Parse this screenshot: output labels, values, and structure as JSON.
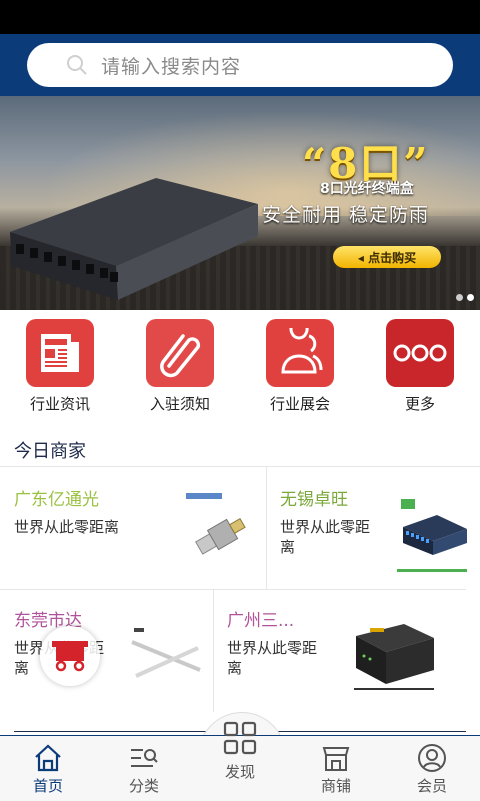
{
  "search": {
    "placeholder": "请输入搜索内容"
  },
  "banner": {
    "title": "“8口”",
    "subtitle": "8口光纤终端盒",
    "tagline": "安全耐用 稳定防雨",
    "cta": "◂ 点击购买",
    "dots_total": 2,
    "active_dot": 2
  },
  "categories": [
    {
      "label": "行业资讯",
      "icon": "newspaper-icon",
      "color": "#e0413f"
    },
    {
      "label": "入驻须知",
      "icon": "paperclip-icon",
      "color": "#e24a4a"
    },
    {
      "label": "行业展会",
      "icon": "people-icon",
      "color": "#e0413f"
    },
    {
      "label": "更多",
      "icon": "more-icon",
      "color": "#c8262a"
    }
  ],
  "today": {
    "title": "今日商家"
  },
  "merchants": [
    {
      "name": "广东亿通光",
      "desc": "世界从此零距离",
      "name_color": "#9bc142"
    },
    {
      "name": "无锡卓旺",
      "desc": "世界从此零距离",
      "name_color": "#7aa83a"
    },
    {
      "name": "东莞市达",
      "desc": "世界从此零距离",
      "name_color": "#b0539a"
    },
    {
      "name": "广州三...",
      "desc": "世界从此零距离",
      "name_color": "#b0539a"
    }
  ],
  "nav": [
    {
      "label": "首页",
      "icon": "home-icon",
      "active": true
    },
    {
      "label": "分类",
      "icon": "category-icon",
      "active": false
    },
    {
      "label": "发现",
      "icon": "grid-icon",
      "active": false
    },
    {
      "label": "商铺",
      "icon": "shop-icon",
      "active": false
    },
    {
      "label": "会员",
      "icon": "user-icon",
      "active": false
    }
  ],
  "colors": {
    "header": "#0c3b7a",
    "accent": "#e0413f"
  }
}
